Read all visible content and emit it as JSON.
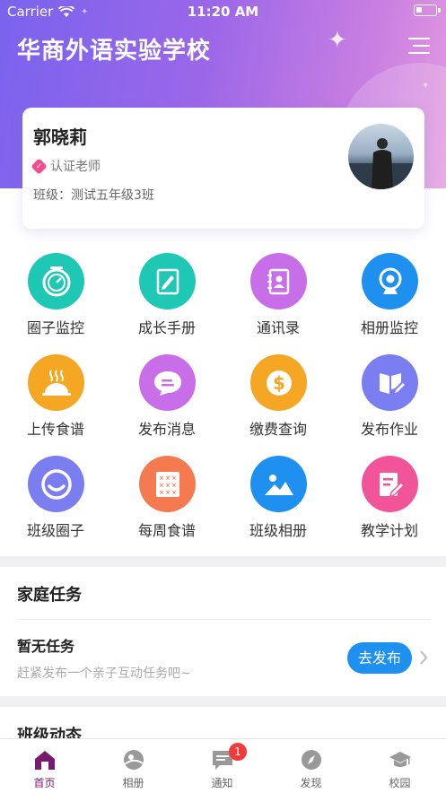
{
  "status_bar": {
    "carrier": "Carrier",
    "time": "11:20 AM"
  },
  "header": {
    "school_name": "华商外语实验学校"
  },
  "profile": {
    "name": "郭晓莉",
    "role": "认证老师",
    "class_info": "班级：测试五年级3班"
  },
  "features": [
    {
      "label": "圈子监控",
      "icon": "stopwatch-icon",
      "color": "#1fc8b4"
    },
    {
      "label": "成长手册",
      "icon": "notebook-pen-icon",
      "color": "#1fc8b4"
    },
    {
      "label": "通讯录",
      "icon": "contacts-book-icon",
      "color": "#c86ee8"
    },
    {
      "label": "相册监控",
      "icon": "webcam-icon",
      "color": "#1e90f0"
    },
    {
      "label": "上传食谱",
      "icon": "food-cloche-icon",
      "color": "#f5a623"
    },
    {
      "label": "发布消息",
      "icon": "chat-bubble-icon",
      "color": "#c86ee8"
    },
    {
      "label": "缴费查询",
      "icon": "dollar-coin-icon",
      "color": "#f5a623"
    },
    {
      "label": "发布作业",
      "icon": "homework-book-icon",
      "color": "#7a7ef0"
    },
    {
      "label": "班级圈子",
      "icon": "smile-circle-icon",
      "color": "#7a7ef0"
    },
    {
      "label": "每周食谱",
      "icon": "calendar-grid-icon",
      "color": "#f57a4f"
    },
    {
      "label": "班级相册",
      "icon": "photo-mountain-icon",
      "color": "#1e90f0"
    },
    {
      "label": "教学计划",
      "icon": "plan-edit-icon",
      "color": "#f2549a"
    }
  ],
  "family_tasks": {
    "title": "家庭任务",
    "empty_title": "暂无任务",
    "empty_hint": "赶紧发布一个亲子互动任务吧~",
    "publish_label": "去发布"
  },
  "class_news": {
    "title": "班级动态"
  },
  "tabbar": [
    {
      "label": "首页",
      "icon": "home-icon",
      "active": true
    },
    {
      "label": "相册",
      "icon": "album-icon",
      "active": false
    },
    {
      "label": "通知",
      "icon": "notification-icon",
      "active": false,
      "badge": "1"
    },
    {
      "label": "发现",
      "icon": "compass-icon",
      "active": false
    },
    {
      "label": "校园",
      "icon": "graduation-cap-icon",
      "active": false
    }
  ],
  "colors": {
    "accent": "#1e90f0",
    "tab_active": "#7a1a6e",
    "badge": "#f23a3a"
  }
}
